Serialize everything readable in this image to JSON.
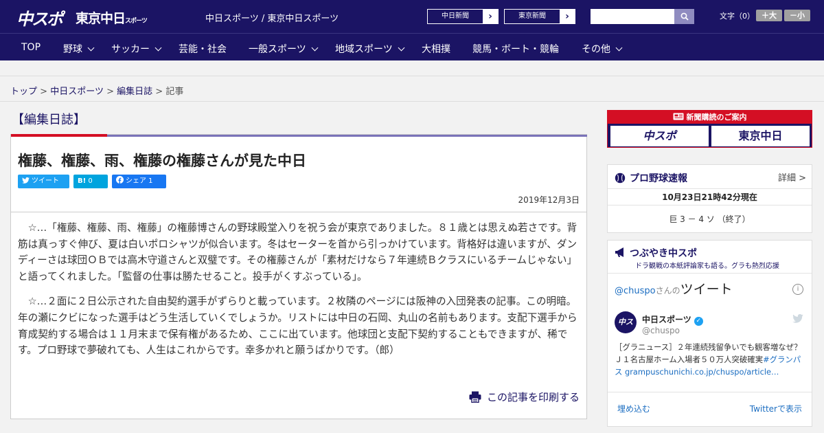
{
  "header": {
    "logo_chuspo": "中スポ",
    "logo_tokyo": "東京中日",
    "logo_tokyo_sub": "スポーツ",
    "site_links": "中日スポーツ / 東京中日スポーツ",
    "paper_buttons": [
      "中日新聞",
      "東京新聞"
    ],
    "search_placeholder": "",
    "font_size_label": "文字（0）",
    "font_plus": "＋大",
    "font_minus": "－小"
  },
  "nav": {
    "items": [
      {
        "label": "TOP",
        "has_dropdown": false
      },
      {
        "label": "野球",
        "has_dropdown": true
      },
      {
        "label": "サッカー",
        "has_dropdown": true
      },
      {
        "label": "芸能・社会",
        "has_dropdown": false
      },
      {
        "label": "一般スポーツ",
        "has_dropdown": true
      },
      {
        "label": "地域スポーツ",
        "has_dropdown": true
      },
      {
        "label": "大相撲",
        "has_dropdown": false
      },
      {
        "label": "競馬・ボート・競輪",
        "has_dropdown": false
      },
      {
        "label": "その他",
        "has_dropdown": true
      }
    ]
  },
  "breadcrumb": {
    "items": [
      "トップ",
      "中日スポーツ",
      "編集日誌"
    ],
    "current": "記事",
    "separator": ">"
  },
  "article": {
    "category": "【編集日誌】",
    "title": "権藤、権藤、雨、権藤の権藤さんが見た中日",
    "share": {
      "tweet": "ツイート",
      "hatena_count": "0",
      "facebook": "シェア 1"
    },
    "date": "2019年12月3日",
    "paragraphs": [
      "☆…「権藤、権藤、雨、権藤」の権藤博さんの野球殿堂入りを祝う会が東京でありました。８１歳とは思えぬ若さです。背筋は真っすぐ伸び、夏は白いポロシャツが似合います。冬はセーターを首から引っかけています。背格好は違いますが、ダンディーさは球団ＯＢでは高木守道さんと双璧です。その権藤さんが「素材だけなら７年連続Ｂクラスにいるチームじゃない」と語ってくれました。「監督の仕事は勝たせること。投手がくすぶっている」。",
      "☆…２面に２日公示された自由契約選手がずらりと載っています。２枚隣のページには阪神の入団発表の記事。この明暗。年の瀬にクビになった選手はどう生活していくでしょうか。リストには中日の石岡、丸山の名前もあります。支配下選手から育成契約する場合は１１月末まで保有権があるため、ここに出ています。他球団と支配下契約することもできますが、稀です。プロ野球で夢破れても、人生はこれからです。幸多かれと願うばかりです。（郎）"
    ],
    "print_label": "この記事を印刷する"
  },
  "sidebar": {
    "subscription": {
      "header": "新聞購読のご案内",
      "logo_a": "中スポ",
      "logo_b": "東京中日"
    },
    "baseball": {
      "title": "プロ野球速報",
      "more": "詳細 >",
      "time": "10月23日21時42分現在",
      "score": "巨 3 － 4 ソ （終了）"
    },
    "tweets": {
      "title": "つぶやき中スポ",
      "subtitle": "ドラ観戦の本紙評論家も語る。グラも熱烈応援",
      "handle": "@chuspo",
      "handle_suffix": "さんの",
      "heading": "ツイート",
      "account_name": "中日スポーツ",
      "account_user": "@chuspo",
      "avatar_text": "中スポ",
      "tweet_text": "［グラニュース］２年連続残留争いでも観客増なぜ？ Ｊ１名古屋ホーム入場者５０万人突破確実",
      "tweet_link": "#グランパス grampuschunichi.co.jp/chuspo/article…",
      "embed": "埋め込む",
      "view_on_twitter": "Twitterで表示"
    }
  },
  "colors": {
    "brand_navy": "#1b1464",
    "accent_red": "#d40f24",
    "link_blue": "#1b6dc1"
  }
}
